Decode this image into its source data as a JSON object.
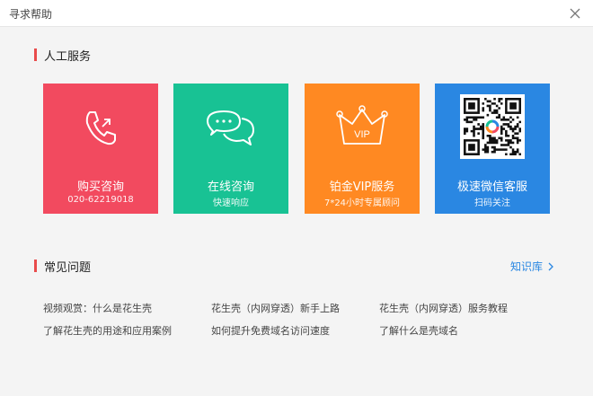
{
  "window": {
    "title": "寻求帮助"
  },
  "service": {
    "heading": "人工服务",
    "cards": [
      {
        "label": "购买咨询",
        "sub": "020-62219018",
        "color": "#f24a5f",
        "icon": "phone-icon"
      },
      {
        "label": "在线咨询",
        "sub": "快速响应",
        "color": "#18c294",
        "icon": "chat-bubbles-icon"
      },
      {
        "label": "铂金VIP服务",
        "sub": "7*24小时专属顾问",
        "color": "#ff8922",
        "icon": "vip-crown-icon",
        "icon_text": "VIP"
      },
      {
        "label": "极速微信客服",
        "sub": "扫码关注",
        "color": "#2a87e2",
        "icon": "qr-code-icon"
      }
    ]
  },
  "faq": {
    "heading": "常见问题",
    "knowledge_link": "知识库",
    "items": [
      "视频观赏：什么是花生壳",
      "花生壳（内网穿透）新手上路",
      "花生壳（内网穿透）服务教程",
      "了解花生壳的用途和应用案例",
      "如何提升免费域名访问速度",
      "了解什么是壳域名"
    ]
  },
  "colors": {
    "accent_red": "#e94b4b",
    "link_blue": "#2a87e2"
  }
}
